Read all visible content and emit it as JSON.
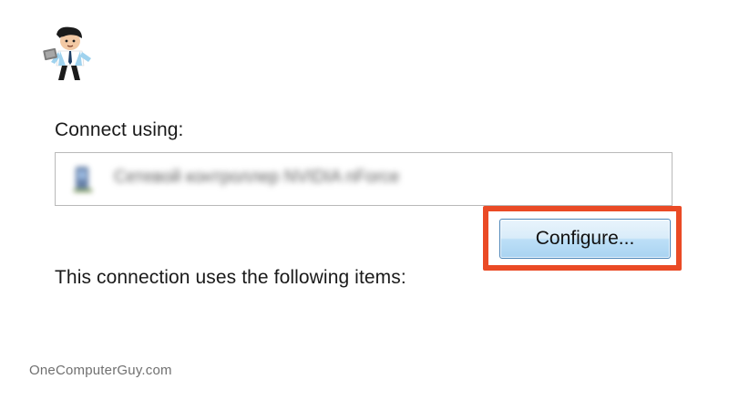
{
  "branding": {
    "logo_icon": "man-with-laptop-icon",
    "watermark": "OneComputerGuy.com"
  },
  "dialog": {
    "connect_label": "Connect using:",
    "adapter": {
      "icon": "network-adapter-icon",
      "name_blurred": "Сетевой контроллер NVIDIA nForce"
    },
    "configure_button": "Configure...",
    "items_label": "This connection uses the following items:"
  },
  "colors": {
    "highlight_border": "#ea4a25",
    "button_border": "#4d86b8",
    "button_fill_top": "#e9f4fc",
    "button_fill_bottom": "#a9d3f1",
    "field_border": "#b9b9b9"
  }
}
